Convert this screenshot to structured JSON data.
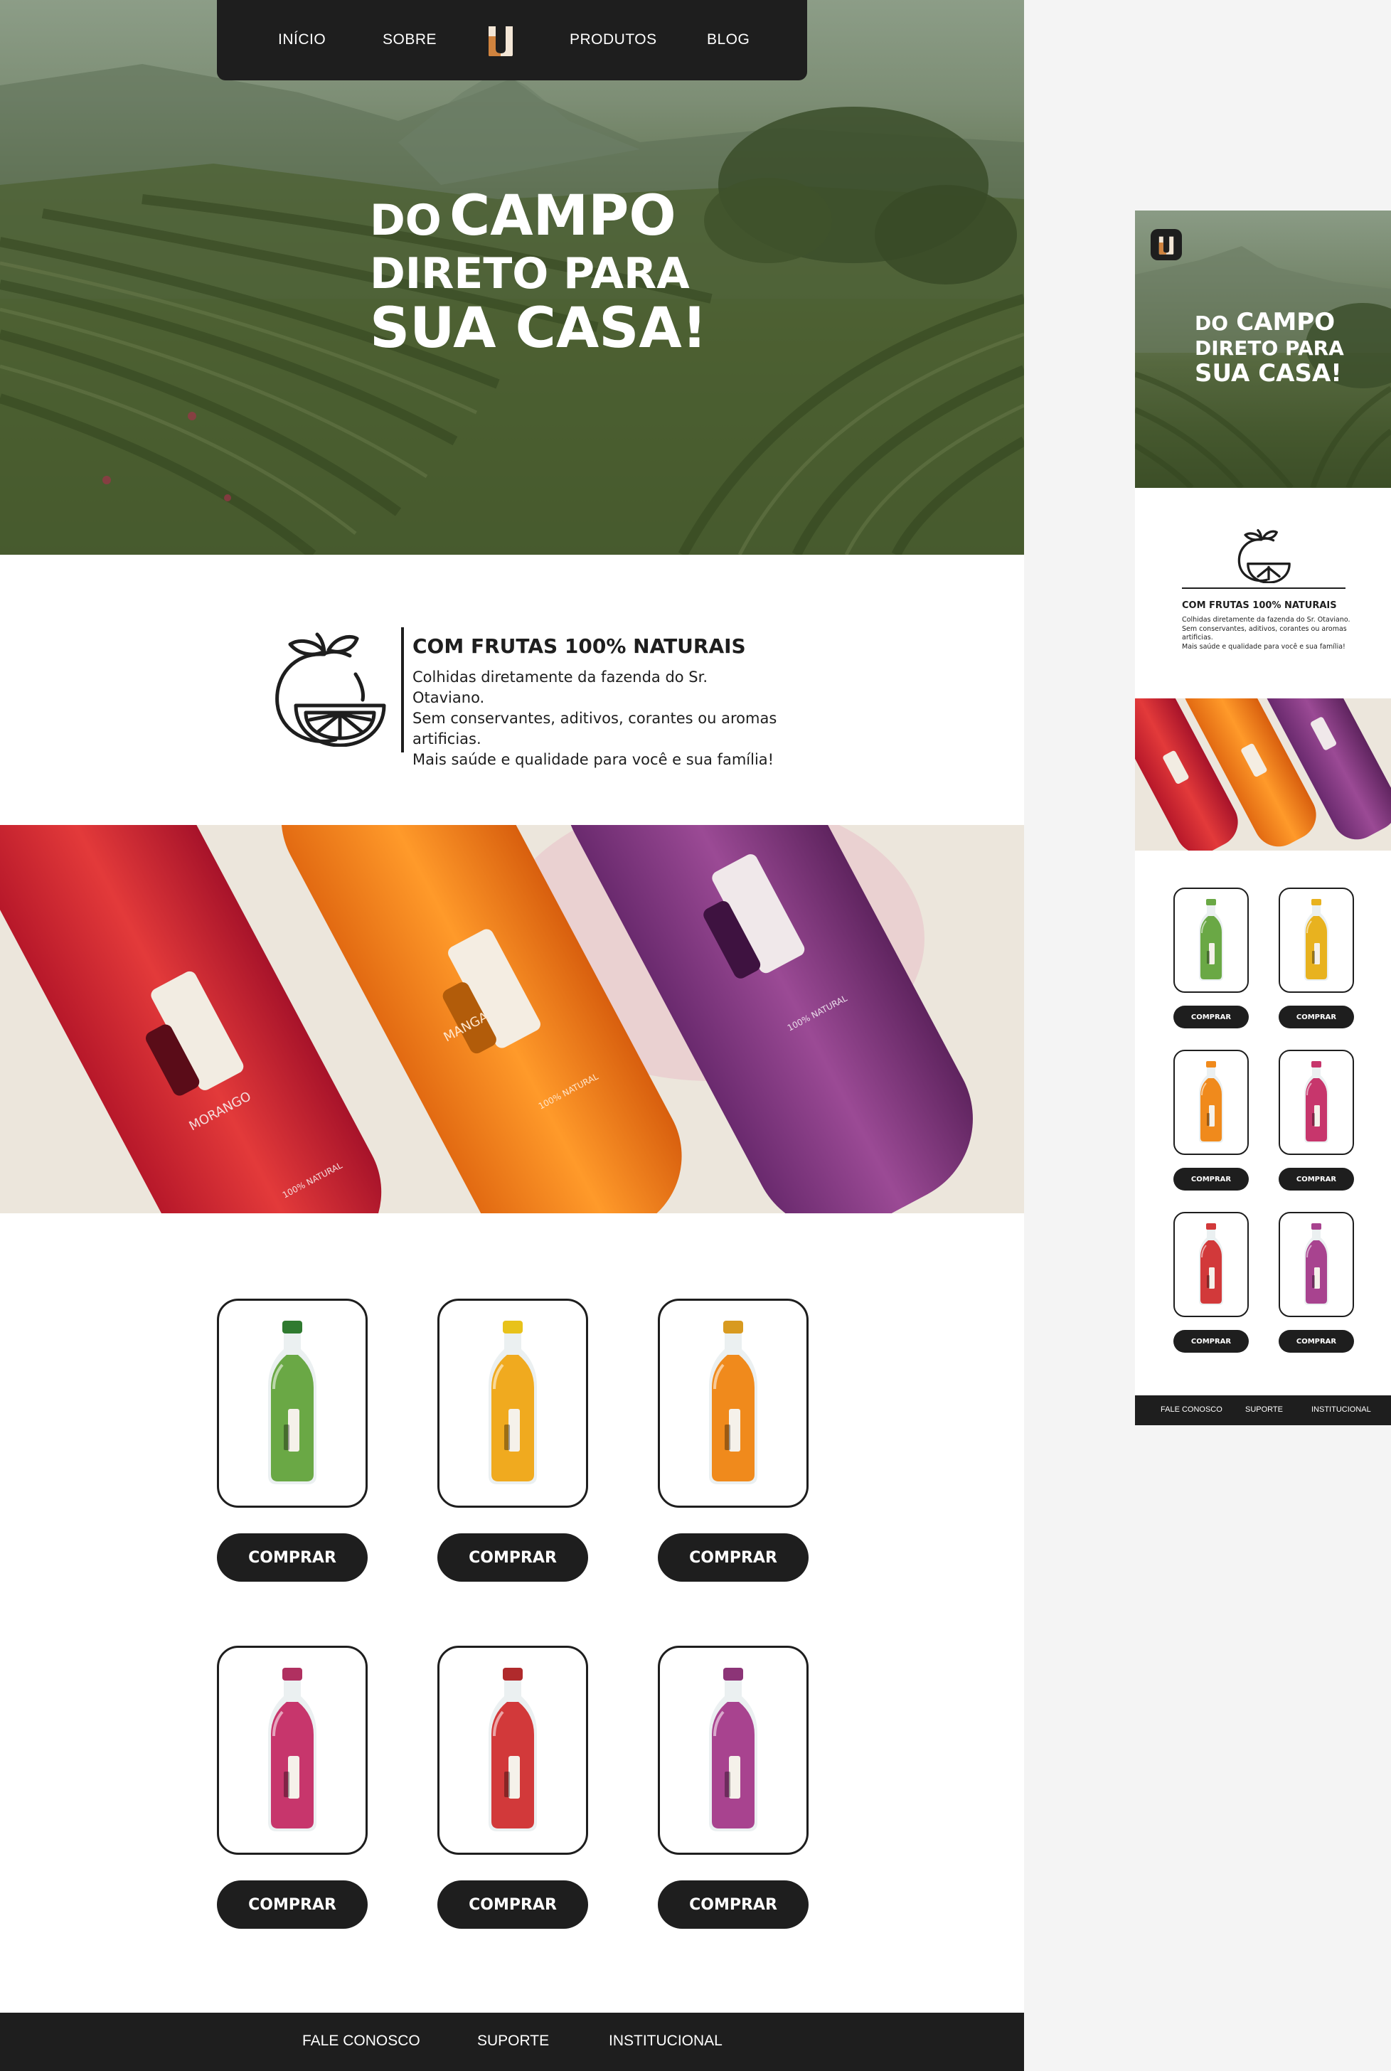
{
  "nav": {
    "items": [
      "INÍCIO",
      "SOBRE",
      "PRODUTOS",
      "BLOG"
    ],
    "logo_icon": "juice-brand-logo"
  },
  "hero": {
    "line1_small": "DO",
    "line1_big": "CAMPO",
    "line2": "DIRETO PARA",
    "line3": "SUA CASA!"
  },
  "feature": {
    "icon": "orange-fruit-icon",
    "title": "COM FRUTAS 100% NATURAIS",
    "text_lines": [
      "Colhidas diretamente da fazenda do Sr. Otaviano.",
      "Sem conservantes, aditivos, corantes ou aromas artificias.",
      "Mais saúde e qualidade para você e sua família!"
    ]
  },
  "banner": {
    "labels": [
      "MORANGO",
      "MANGA",
      "100% NATURAL",
      "100% NATURAL",
      "100% NATURAL"
    ]
  },
  "products": {
    "button_label": "COMPRAR",
    "items": [
      {
        "flavor_color": "#6aa845",
        "cap_color": "#2f7a2f"
      },
      {
        "flavor_color": "#f0aa1f",
        "cap_color": "#e8c21a"
      },
      {
        "flavor_color": "#f08a1c",
        "cap_color": "#d89a20"
      },
      {
        "flavor_color": "#c7366c",
        "cap_color": "#b03060"
      },
      {
        "flavor_color": "#d2393a",
        "cap_color": "#b02a2c"
      },
      {
        "flavor_color": "#a8438f",
        "cap_color": "#8c3477"
      }
    ]
  },
  "footer": {
    "links": [
      "FALE CONOSCO",
      "SUPORTE",
      "INSTITUCIONAL"
    ]
  },
  "mobile": {
    "hero": {
      "line1_small": "DO",
      "line1_big": "CAMPO",
      "line2": "DIRETO PARA",
      "line3": "SUA CASA!"
    },
    "feature": {
      "title": "COM FRUTAS 100% NATURAIS",
      "text_lines": [
        "Colhidas diretamente da fazenda do Sr. Otaviano.",
        "Sem conservantes, aditivos, corantes ou aromas artificias.",
        "Mais saúde e qualidade para você e sua família!"
      ]
    },
    "button_label": "COMPRAR",
    "product_colors": [
      "#6aa845",
      "#e8b21f",
      "#f08a1c",
      "#c7366c",
      "#d2393a",
      "#a8438f"
    ],
    "footer_links": [
      "FALE CONOSCO",
      "SUPORTE",
      "INSTITUCIONAL"
    ]
  },
  "colors": {
    "dark": "#1e1e1e",
    "white": "#ffffff",
    "canvas": "#f4f4f4"
  }
}
